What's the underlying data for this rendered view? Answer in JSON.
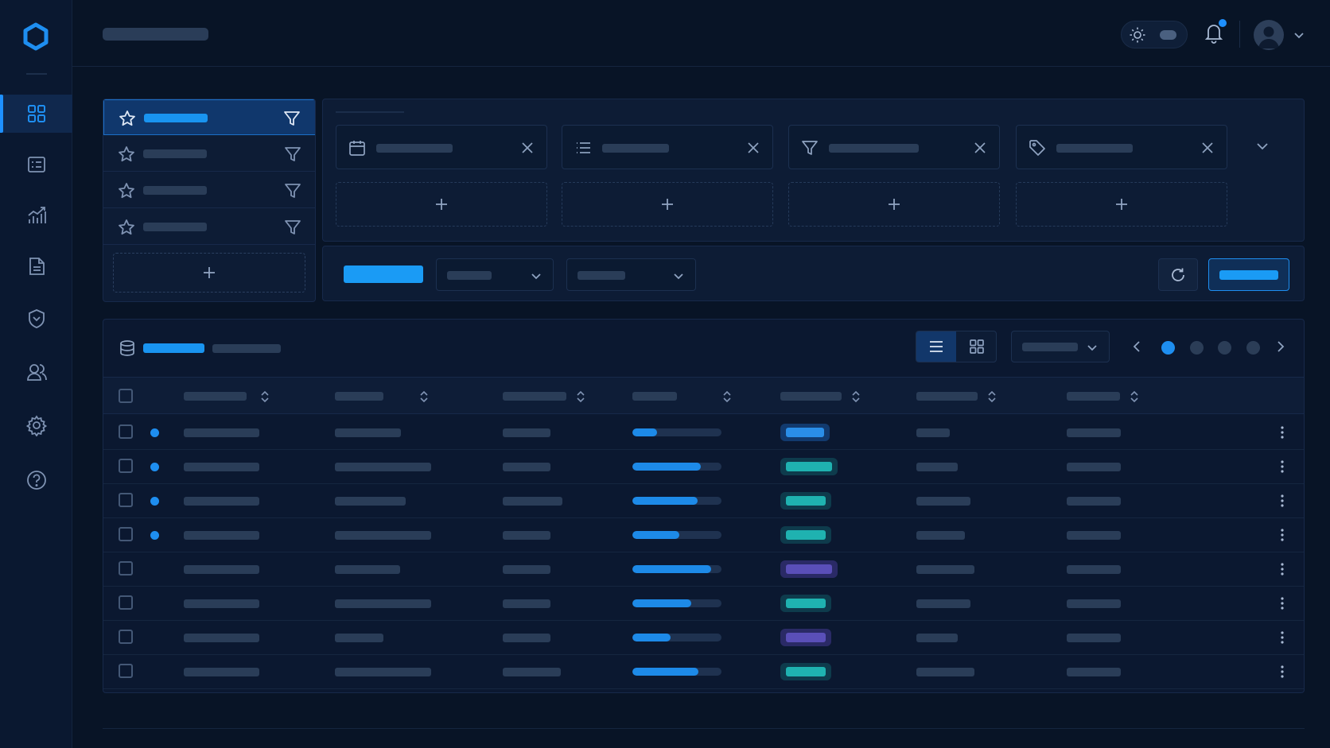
{
  "colors": {
    "accent": "#1e8ef0",
    "bg": "#081426",
    "panel": "#0d1c35",
    "placeholder": "#2a3d58",
    "status_blue": "#1e8ef0",
    "status_teal": "#1fb2b0",
    "status_purple": "#5a4fb8"
  },
  "sidebar": {
    "logo": "ring-logo",
    "items": [
      {
        "icon": "grid-icon",
        "active": true
      },
      {
        "icon": "list-icon",
        "active": false
      },
      {
        "icon": "chart-icon",
        "active": false
      },
      {
        "icon": "document-icon",
        "active": false
      },
      {
        "icon": "shield-icon",
        "active": false
      },
      {
        "icon": "users-icon",
        "active": false
      },
      {
        "icon": "gear-icon",
        "active": false
      },
      {
        "icon": "help-icon",
        "active": false
      }
    ]
  },
  "header": {
    "theme_toggle_icon": "sun-icon",
    "notifications_unread": true,
    "avatar": "user-avatar"
  },
  "saved_filters": {
    "active_index": 0,
    "count": 4
  },
  "filter_chips": [
    "calendar-icon",
    "list-icon",
    "filter-icon",
    "tag-icon"
  ],
  "table": {
    "view_mode": "list",
    "current_page": 1,
    "total_pages": 4,
    "rows": [
      {
        "unread": true,
        "progress": 0.28,
        "status": "blue"
      },
      {
        "unread": true,
        "progress": 0.77,
        "status": "teal"
      },
      {
        "unread": true,
        "progress": 0.73,
        "status": "teal"
      },
      {
        "unread": true,
        "progress": 0.53,
        "status": "teal"
      },
      {
        "unread": false,
        "progress": 0.88,
        "status": "purple"
      },
      {
        "unread": false,
        "progress": 0.66,
        "status": "teal"
      },
      {
        "unread": false,
        "progress": 0.43,
        "status": "purple"
      },
      {
        "unread": false,
        "progress": 0.74,
        "status": "teal"
      }
    ]
  }
}
